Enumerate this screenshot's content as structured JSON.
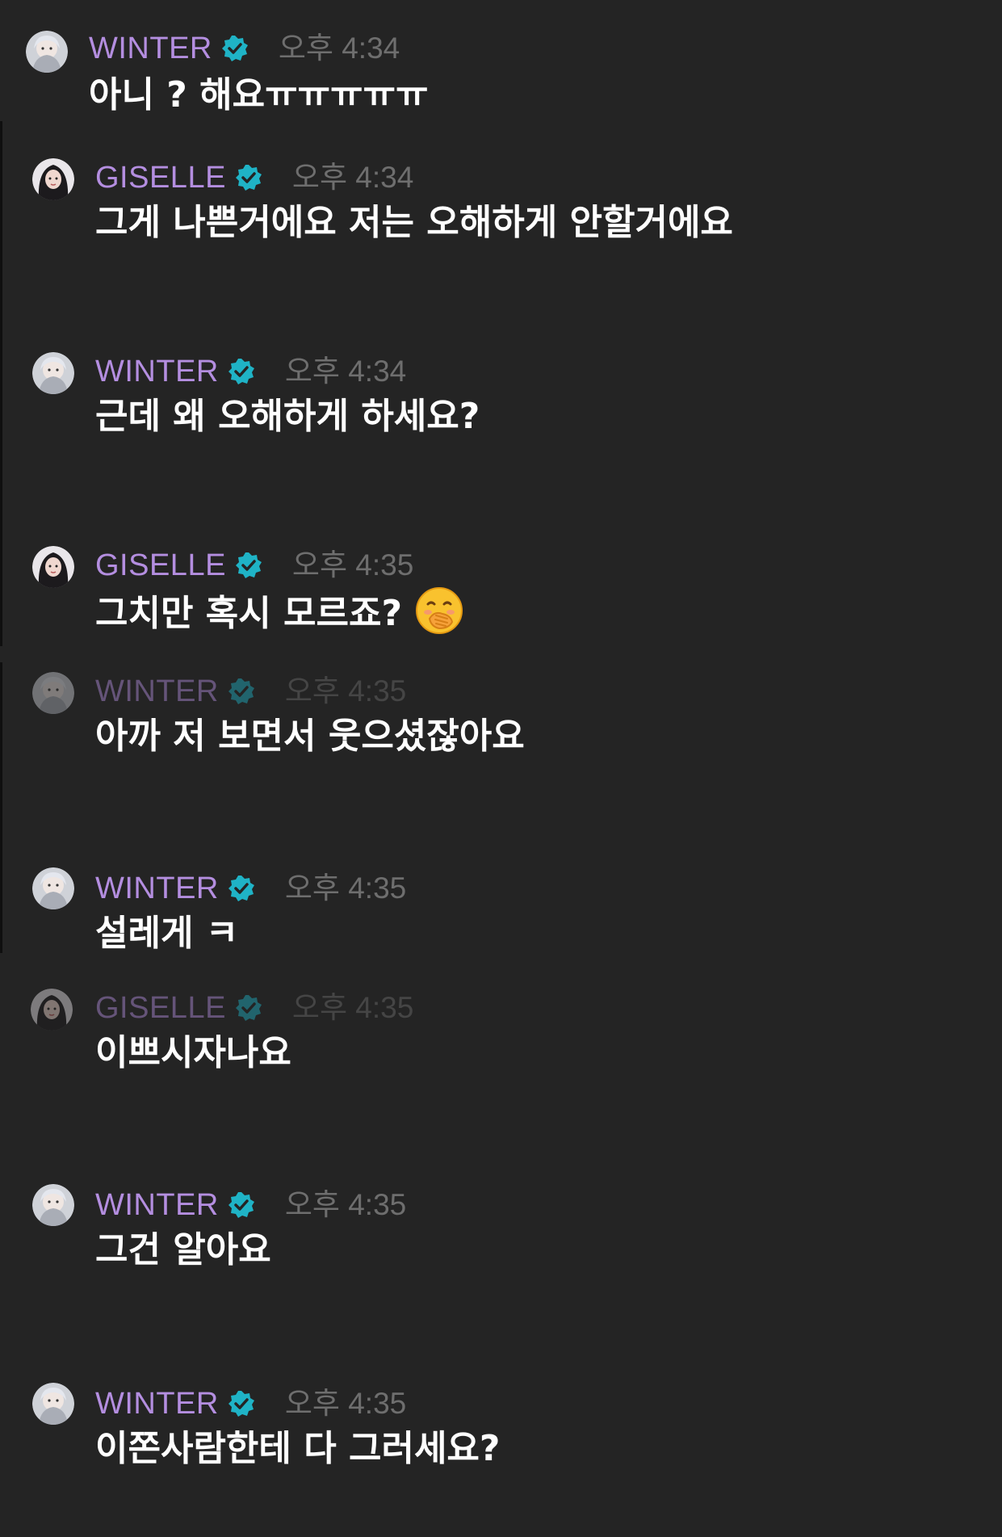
{
  "colors": {
    "background": "#242424",
    "name": "#b48ee0",
    "time": "#6e6e6e",
    "text": "#ffffff",
    "verified": "#1fb3c6"
  },
  "icons": {
    "verified": "verified-badge-icon",
    "emoji": "face-with-hand-over-mouth-emoji"
  },
  "messages": [
    {
      "sender": "WINTER",
      "time": "오후 4:34",
      "text": "아니 ? 해요ㅠㅠㅠㅠㅠ"
    },
    {
      "sender": "GISELLE",
      "time": "오후 4:34",
      "text": "그게 나쁜거에요 저는 오해하게 안할거에요"
    },
    {
      "sender": "WINTER",
      "time": "오후 4:34",
      "text": "근데 왜 오해하게 하세요?"
    },
    {
      "sender": "GISELLE",
      "time": "오후 4:35",
      "text": "그치만 혹시 모르죠?"
    },
    {
      "sender": "WINTER",
      "time": "오후 4:35",
      "text": "아까 저 보면서 웃으셨잖아요"
    },
    {
      "sender": "WINTER",
      "time": "오후 4:35",
      "text": "설레게 ㅋ"
    },
    {
      "sender": "GISELLE",
      "time": "오후 4:35",
      "text": "이쁘시자나요"
    },
    {
      "sender": "WINTER",
      "time": "오후 4:35",
      "text": "그건 알아요"
    },
    {
      "sender": "WINTER",
      "time": "오후 4:35",
      "text": "이쫀사람한테 다 그러세요?"
    }
  ]
}
